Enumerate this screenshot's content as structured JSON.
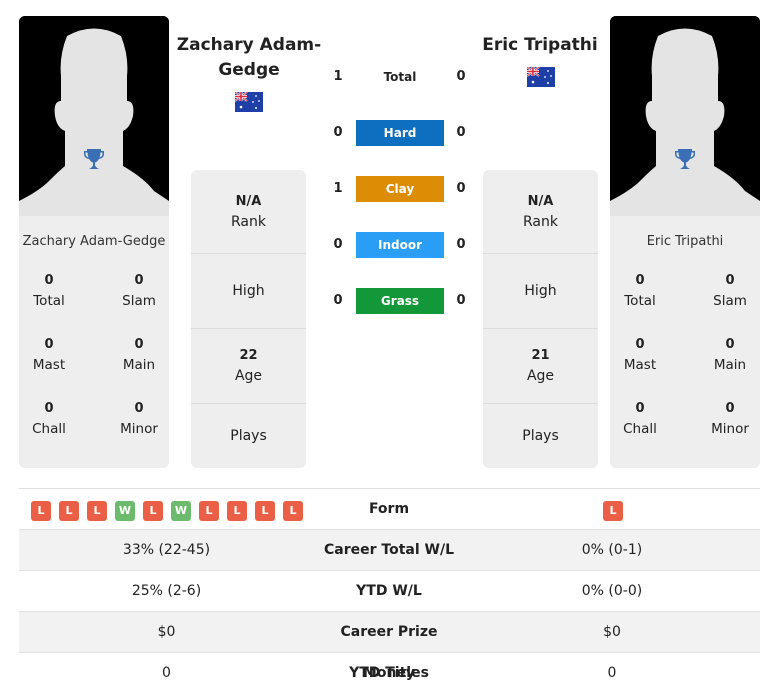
{
  "player1": {
    "name": "Zachary Adam-Gedge",
    "name_line1": "Zachary Adam-",
    "name_line2": "Gedge",
    "country_flag": "australia-flag",
    "card_name": "Zachary Adam-Gedge",
    "titles": {
      "total": {
        "value": "0",
        "label": "Total"
      },
      "slam": {
        "value": "0",
        "label": "Slam"
      },
      "mast": {
        "value": "0",
        "label": "Mast"
      },
      "main": {
        "value": "0",
        "label": "Main"
      },
      "chall": {
        "value": "0",
        "label": "Chall"
      },
      "minor": {
        "value": "0",
        "label": "Minor"
      }
    },
    "rank": {
      "value": "N/A",
      "label": "Rank"
    },
    "high": {
      "label": "High"
    },
    "age": {
      "value": "22",
      "label": "Age"
    },
    "plays": {
      "label": "Plays"
    },
    "form": [
      "L",
      "L",
      "L",
      "W",
      "L",
      "W",
      "L",
      "L",
      "L",
      "L"
    ]
  },
  "player2": {
    "name": "Eric Tripathi",
    "country_flag": "australia-flag",
    "card_name": "Eric Tripathi",
    "titles": {
      "total": {
        "value": "0",
        "label": "Total"
      },
      "slam": {
        "value": "0",
        "label": "Slam"
      },
      "mast": {
        "value": "0",
        "label": "Mast"
      },
      "main": {
        "value": "0",
        "label": "Main"
      },
      "chall": {
        "value": "0",
        "label": "Chall"
      },
      "minor": {
        "value": "0",
        "label": "Minor"
      }
    },
    "rank": {
      "value": "N/A",
      "label": "Rank"
    },
    "high": {
      "label": "High"
    },
    "age": {
      "value": "21",
      "label": "Age"
    },
    "plays": {
      "label": "Plays"
    },
    "form": [
      "L"
    ]
  },
  "h2h": [
    {
      "label": "Total",
      "p1": "1",
      "p2": "0",
      "color": ""
    },
    {
      "label": "Hard",
      "p1": "0",
      "p2": "0",
      "color": "#0e6ebf"
    },
    {
      "label": "Clay",
      "p1": "1",
      "p2": "0",
      "color": "#dc8c05"
    },
    {
      "label": "Indoor",
      "p1": "0",
      "p2": "0",
      "color": "#2a9ef5"
    },
    {
      "label": "Grass",
      "p1": "0",
      "p2": "0",
      "color": "#129739"
    }
  ],
  "stats": [
    {
      "label": "Form",
      "p1": "",
      "p2": ""
    },
    {
      "label": "Career Total W/L",
      "p1": "33% (22-45)",
      "p2": "0% (0-1)"
    },
    {
      "label": "YTD W/L",
      "p1": "25% (2-6)",
      "p2": "0% (0-0)"
    },
    {
      "label": "Career Prize Money",
      "p1": "$0",
      "p2": "$0"
    },
    {
      "label": "YTD Titles",
      "p1": "0",
      "p2": "0"
    }
  ],
  "colors": {
    "loss": "#ec5f47",
    "win": "#6cbb6c",
    "trophy": "#3a6fb5"
  }
}
